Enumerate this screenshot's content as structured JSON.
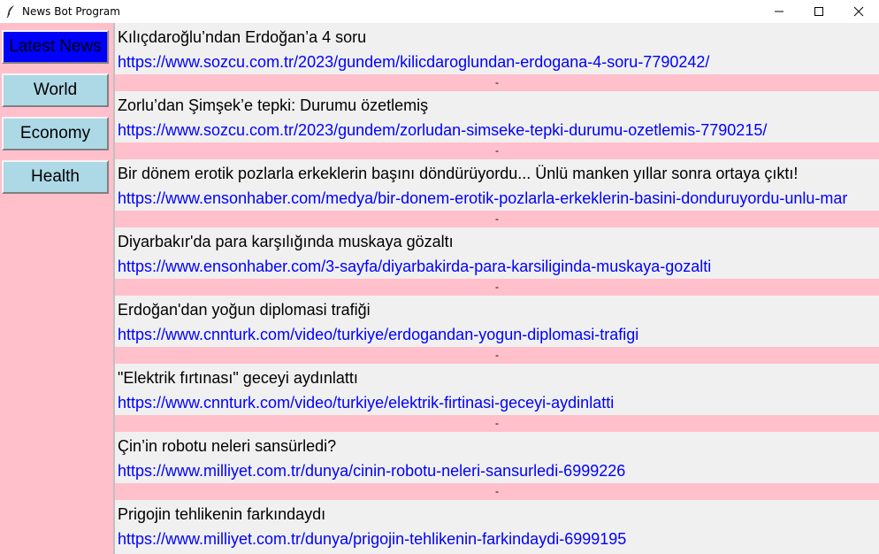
{
  "window": {
    "title": "News Bot Program"
  },
  "sidebar": {
    "buttons": [
      {
        "label": "Latest News"
      },
      {
        "label": "World"
      },
      {
        "label": "Economy"
      },
      {
        "label": "Health"
      }
    ]
  },
  "news": {
    "separator": "-",
    "items": [
      {
        "title": "Kılıçdaroğlu’ndan Erdoğan’a 4 soru",
        "url": "https://www.sozcu.com.tr/2023/gundem/kilicdaroglundan-erdogana-4-soru-7790242/"
      },
      {
        "title": "Zorlu’dan Şimşek’e tepki: Durumu özetlemiş",
        "url": "https://www.sozcu.com.tr/2023/gundem/zorludan-simseke-tepki-durumu-ozetlemis-7790215/"
      },
      {
        "title": "Bir dönem erotik pozlarla erkeklerin başını döndürüyordu... Ünlü manken yıllar sonra ortaya çıktı!",
        "url": "https://www.ensonhaber.com/medya/bir-donem-erotik-pozlarla-erkeklerin-basini-donduruyordu-unlu-mar"
      },
      {
        "title": "Diyarbakır'da para karşılığında muskaya gözaltı",
        "url": "https://www.ensonhaber.com/3-sayfa/diyarbakirda-para-karsiliginda-muskaya-gozalti"
      },
      {
        "title": "Erdoğan'dan yoğun diplomasi trafiği",
        "url": "https://www.cnnturk.com/video/turkiye/erdogandan-yogun-diplomasi-trafigi"
      },
      {
        "title": "\"Elektrik fırtınası\" geceyi aydınlattı",
        "url": "https://www.cnnturk.com/video/turkiye/elektrik-firtinasi-geceyi-aydinlatti"
      },
      {
        "title": "Çin’in robotu neleri sansürledi?",
        "url": "https://www.milliyet.com.tr/dunya/cinin-robotu-neleri-sansurledi-6999226"
      },
      {
        "title": "Prigojin tehlikenin farkındaydı",
        "url": "https://www.milliyet.com.tr/dunya/prigojin-tehlikenin-farkindaydi-6999195"
      }
    ]
  }
}
